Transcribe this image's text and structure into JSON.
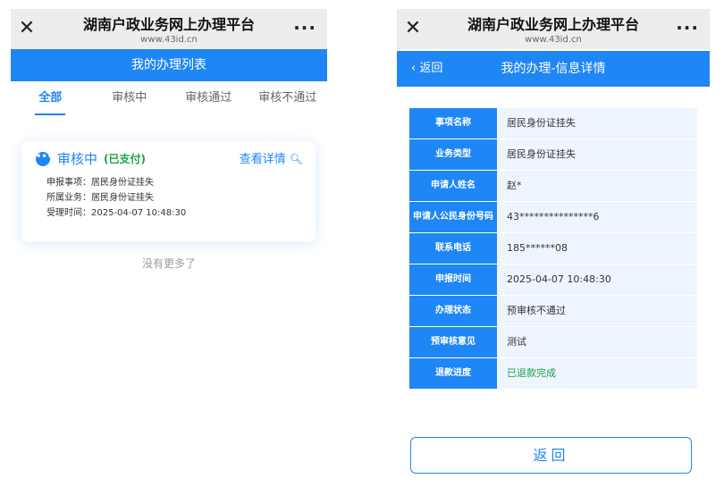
{
  "left": {
    "topbar": {
      "close": "✕",
      "title": "湖南户政业务网上办理平台",
      "domain": "www.43id.cn",
      "more": "···"
    },
    "header": "我的办理列表",
    "tabs": [
      "全部",
      "审核中",
      "审核通过",
      "审核不通过"
    ],
    "card": {
      "status": "审核中",
      "paid": "(已支付)",
      "detail_link": "查看详情",
      "rows": [
        "申报事项：居民身份证挂失",
        "所属业务：居民身份证挂失",
        "受理时间：2025-04-07 10:48:30"
      ]
    },
    "no_more": "没有更多了"
  },
  "right": {
    "topbar": {
      "close": "✕",
      "title": "湖南户政业务网上办理平台",
      "domain": "www.43id.cn",
      "more": "···"
    },
    "back": "返回",
    "header": "我的办理-信息详情",
    "rows": [
      {
        "label": "事项名称",
        "value": "居民身份证挂失"
      },
      {
        "label": "业务类型",
        "value": "居民身份证挂失"
      },
      {
        "label": "申请人姓名",
        "value": "赵*"
      },
      {
        "label": "申请人公民身份号码",
        "value": "43***************6"
      },
      {
        "label": "联系电话",
        "value": "185******08"
      },
      {
        "label": "申报时间",
        "value": "2025-04-07 10:48:30"
      },
      {
        "label": "办理状态",
        "value": "预审核不通过"
      },
      {
        "label": "预审核意见",
        "value": "测试"
      },
      {
        "label": "退款进度",
        "value": "已退款完成"
      }
    ],
    "back_button": "返回"
  },
  "colors": {
    "accent": "#1f86f5",
    "success": "#1aa34a",
    "topbar": "#ededed",
    "cell": "#eef5ff"
  }
}
